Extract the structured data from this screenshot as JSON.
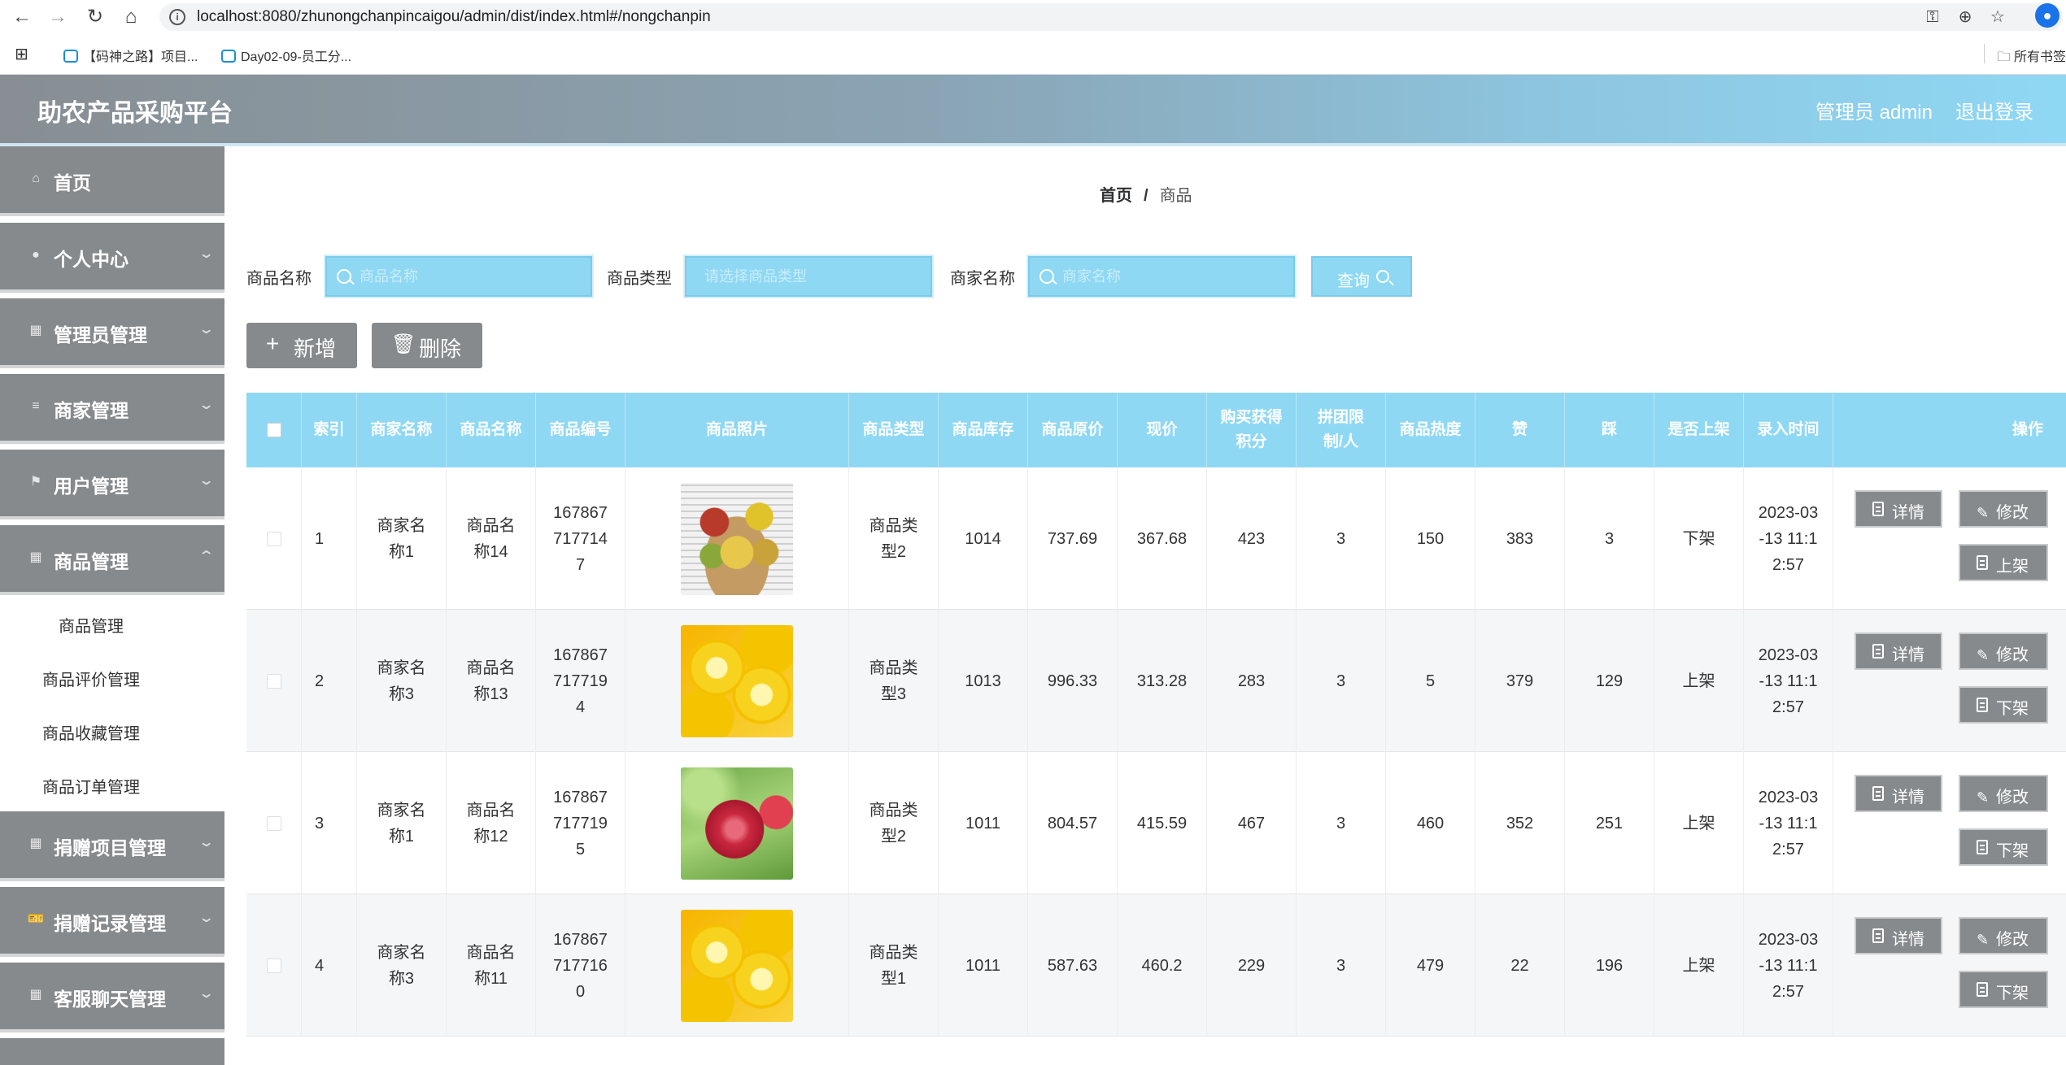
{
  "browser": {
    "url": "localhost:8080/zhunongchanpincaigou/admin/dist/index.html#/nongchanpin",
    "bookmarks": [
      "【码神之路】项目...",
      "Day02-09-员工分..."
    ],
    "bookmarks_right": "所有书签"
  },
  "header": {
    "brand": "助农产品采购平台",
    "user": "管理员 admin",
    "logout": "退出登录"
  },
  "sidebar": {
    "items": [
      {
        "label": "首页",
        "icon": "home-icon"
      },
      {
        "label": "个人中心",
        "icon": "user-icon"
      },
      {
        "label": "管理员管理",
        "icon": "grid-icon"
      },
      {
        "label": "商家管理",
        "icon": "menu-icon"
      },
      {
        "label": "用户管理",
        "icon": "flag-icon"
      },
      {
        "label": "商品管理",
        "icon": "grid-icon"
      },
      {
        "label": "捐赠项目管理",
        "icon": "grid-icon"
      },
      {
        "label": "捐赠记录管理",
        "icon": "ticket-icon"
      },
      {
        "label": "客服聊天管理",
        "icon": "grid-icon"
      }
    ],
    "sub_items": [
      "商品管理",
      "商品评价管理",
      "商品收藏管理",
      "商品订单管理"
    ]
  },
  "breadcrumb": {
    "home": "首页",
    "separator": "/",
    "current": "商品"
  },
  "filters": {
    "name_label": "商品名称",
    "name_placeholder": "商品名称",
    "type_label": "商品类型",
    "type_placeholder": "请选择商品类型",
    "merchant_label": "商家名称",
    "merchant_placeholder": "商家名称",
    "query_label": "查询"
  },
  "actions": {
    "add": "新增",
    "delete": "删除"
  },
  "table": {
    "columns": [
      "索引",
      "商家名称",
      "商品名称",
      "商品编号",
      "商品照片",
      "商品类型",
      "商品库存",
      "商品原价",
      "现价",
      "购买获得积分",
      "拼团限制/人",
      "商品热度",
      "赞",
      "踩",
      "是否上架",
      "录入时间",
      "操作"
    ],
    "rows": [
      {
        "index": "1",
        "merchant": "商家名称1",
        "name": "商品名称14",
        "code": "1678677177147",
        "photo": "fruit-mix",
        "type": "商品类型2",
        "stock": "1014",
        "orig_price": "737.69",
        "price": "367.68",
        "points": "423",
        "group_limit": "3",
        "heat": "150",
        "likes": "383",
        "dislikes": "3",
        "on_shelf": "下架",
        "created": "2023-03-13 11:12:57",
        "toggle": "上架"
      },
      {
        "index": "2",
        "merchant": "商家名称3",
        "name": "商品名称13",
        "code": "1678677177194",
        "photo": "lemon",
        "type": "商品类型3",
        "stock": "1013",
        "orig_price": "996.33",
        "price": "313.28",
        "points": "283",
        "group_limit": "3",
        "heat": "5",
        "likes": "379",
        "dislikes": "129",
        "on_shelf": "上架",
        "created": "2023-03-13 11:12:57",
        "toggle": "下架"
      },
      {
        "index": "3",
        "merchant": "商家名称1",
        "name": "商品名称12",
        "code": "1678677177195",
        "photo": "apple",
        "type": "商品类型2",
        "stock": "1011",
        "orig_price": "804.57",
        "price": "415.59",
        "points": "467",
        "group_limit": "3",
        "heat": "460",
        "likes": "352",
        "dislikes": "251",
        "on_shelf": "上架",
        "created": "2023-03-13 11:12:57",
        "toggle": "下架"
      },
      {
        "index": "4",
        "merchant": "商家名称3",
        "name": "商品名称11",
        "code": "1678677177160",
        "photo": "lemon",
        "type": "商品类型1",
        "stock": "1011",
        "orig_price": "587.63",
        "price": "460.2",
        "points": "229",
        "group_limit": "3",
        "heat": "479",
        "likes": "22",
        "dislikes": "196",
        "on_shelf": "上架",
        "created": "2023-03-13 11:12:57",
        "toggle": "下架"
      }
    ],
    "op_detail": "详情",
    "op_edit": "修改"
  },
  "colors": {
    "accent": "#8fd8f4",
    "menu": "#868a8d"
  }
}
